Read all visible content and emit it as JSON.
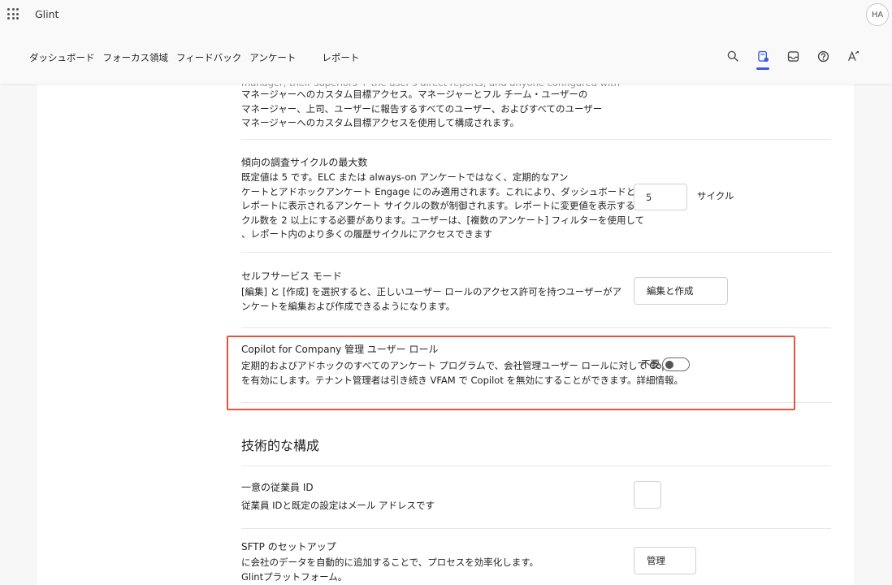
{
  "app": {
    "waffle_icon": "waffle-icon",
    "name": "Glint",
    "avatar_initials": "HA"
  },
  "nav": {
    "items": [
      "ダッシュボード",
      "フォーカス領域",
      "フィードバック",
      "アンケート",
      "レポート"
    ]
  },
  "toolbar": {
    "icons": [
      "search-icon",
      "survey-settings-icon",
      "inbox-icon",
      "help-icon",
      "accessibility-icon"
    ],
    "accent": "#3b5bdb"
  },
  "settings": {
    "access_section": {
      "faded_line": "manager, their superiors + the user's direct reports, and anyone configured with",
      "lines": [
        "マネージャーへのカスタム目標アクセス。マネージャーとフル チーム・ユーザーの",
        "マネージャー、上司、ユーザーに報告するすべてのユーザー、およびすべてのユーザー",
        "マネージャーへのカスタム目標アクセスを使用して構成されます。"
      ]
    },
    "trend_cycles": {
      "title": "傾向の調査サイクルの最大数",
      "lines": [
        "既定値は 5 です。ELC または always-on アンケートではなく、定期的なアン",
        "ケートとアドホックアンケート Engage にのみ適用されます。これにより、ダッシュボードと",
        "レポートに表示されるアンケート サイクルの数が制御されます。レポートに変更値を表示するには、サイ",
        "クル数を 2 以上にする必要があります。ユーザーは、[複数のアンケート] フィルターを使用して",
        "、レポート内のより多くの履歴サイクルにアクセスできます"
      ],
      "value": "5",
      "unit": "サイクル"
    },
    "self_service": {
      "title": "セルフサービス モード",
      "lines": [
        "[編集] と [作成] を選択すると、正しいユーザー ロールのアクセス許可を持つユーザーがア",
        "ンケートを編集および作成できるようになります。"
      ],
      "button": "編集と作成"
    },
    "copilot": {
      "title": "Copilot for Company 管理 ユーザー ロール",
      "lines": [
        "定期的およびアドホックのすべてのアンケート プログラムで、会社管理ユーザー ロールに対して Copilot",
        "を有効にします。テナント管理者は引き続き VFAM で Copilot を無効にすることができます。詳細情報。"
      ],
      "toggle_label": "不要",
      "toggle_on": false,
      "highlight_color": "#e8533f"
    },
    "technical": {
      "heading": "技術的な構成"
    },
    "employee_id": {
      "title": "一意の従業員 ID",
      "line": "従業員 IDと既定の設定はメール アドレスです",
      "value": ""
    },
    "sftp": {
      "title": "SFTP のセットアップ",
      "lines": [
        "に会社のデータを自動的に追加することで、プロセスを効率化します。",
        "Glintプラットフォーム。"
      ],
      "button": "管理"
    }
  }
}
